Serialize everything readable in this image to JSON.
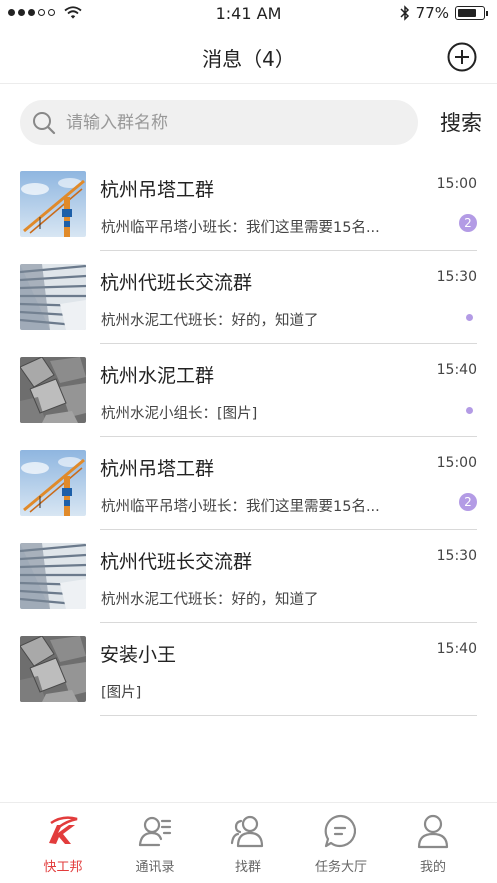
{
  "status_bar": {
    "time": "1:41 AM",
    "battery_text": "77%",
    "battery_level": 0.77,
    "bluetooth": "bluetooth-icon",
    "wifi": "wifi-icon"
  },
  "nav": {
    "title": "消息（4）",
    "add_icon": "plus-circle-icon"
  },
  "search": {
    "placeholder": "请输入群名称",
    "button_label": "搜索"
  },
  "colors": {
    "accent_active": "#e23c3c",
    "badge": "#b39be5",
    "tab_inactive": "#666666"
  },
  "messages": [
    {
      "name": "杭州吊塔工群",
      "time": "15:00",
      "preview": "杭州临平吊塔小班长：我们这里需要15名...",
      "unread": "2",
      "avatar": "crane"
    },
    {
      "name": "杭州代班长交流群",
      "time": "15:30",
      "preview": "杭州水泥工代班长：好的，知道了",
      "unread": "dot",
      "avatar": "building"
    },
    {
      "name": "杭州水泥工群",
      "time": "15:40",
      "preview": "杭州水泥小组长：[图片]",
      "unread": "dot",
      "avatar": "concrete"
    },
    {
      "name": "杭州吊塔工群",
      "time": "15:00",
      "preview": "杭州临平吊塔小班长：我们这里需要15名...",
      "unread": "2",
      "avatar": "crane"
    },
    {
      "name": "杭州代班长交流群",
      "time": "15:30",
      "preview": "杭州水泥工代班长：好的，知道了",
      "unread": "",
      "avatar": "building"
    },
    {
      "name": "安装小王",
      "time": "15:40",
      "preview": "[图片]",
      "unread": "",
      "avatar": "concrete"
    }
  ],
  "tabs": [
    {
      "label": "快工邦",
      "icon": "kuaigongbang-logo-icon",
      "active": true
    },
    {
      "label": "通讯录",
      "icon": "contacts-icon",
      "active": false
    },
    {
      "label": "找群",
      "icon": "group-icon",
      "active": false
    },
    {
      "label": "任务大厅",
      "icon": "chat-bubble-icon",
      "active": false
    },
    {
      "label": "我的",
      "icon": "person-icon",
      "active": false
    }
  ]
}
